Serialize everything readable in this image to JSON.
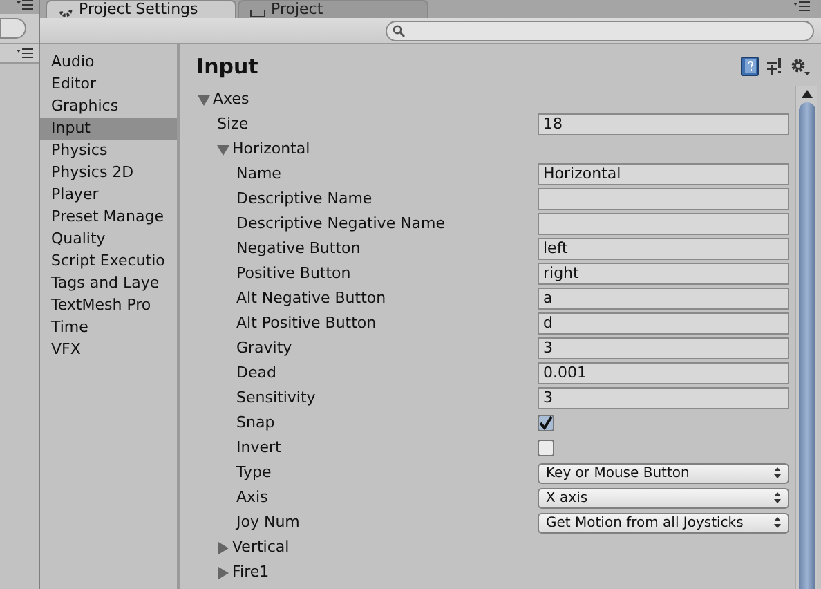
{
  "tabs": [
    {
      "label": "Project Settings",
      "selected": true
    },
    {
      "label": "Project",
      "selected": false
    }
  ],
  "sidebar": {
    "items": [
      {
        "label": "Audio",
        "selected": false
      },
      {
        "label": "Editor",
        "selected": false
      },
      {
        "label": "Graphics",
        "selected": false
      },
      {
        "label": "Input",
        "selected": true
      },
      {
        "label": "Physics",
        "selected": false
      },
      {
        "label": "Physics 2D",
        "selected": false
      },
      {
        "label": "Player",
        "selected": false
      },
      {
        "label": "Preset Manage",
        "selected": false
      },
      {
        "label": "Quality",
        "selected": false
      },
      {
        "label": "Script Executio",
        "selected": false
      },
      {
        "label": "Tags and Laye",
        "selected": false
      },
      {
        "label": "TextMesh Pro",
        "selected": false
      },
      {
        "label": "Time",
        "selected": false
      },
      {
        "label": "VFX",
        "selected": false
      }
    ]
  },
  "page_title": "Input",
  "properties": [
    {
      "kind": "foldout",
      "label": "Axes",
      "expanded": true,
      "children": [
        {
          "kind": "field",
          "label": "Size",
          "value": "18"
        },
        {
          "kind": "foldout",
          "label": "Horizontal",
          "expanded": true,
          "children": [
            {
              "kind": "field",
              "label": "Name",
              "value": "Horizontal"
            },
            {
              "kind": "field",
              "label": "Descriptive Name"
            },
            {
              "kind": "field",
              "label": "Descriptive Negative Name"
            },
            {
              "kind": "field",
              "label": "Negative Button",
              "value": "left"
            },
            {
              "kind": "field",
              "label": "Positive Button",
              "value": "right"
            },
            {
              "kind": "field",
              "label": "Alt Negative Button",
              "value": "a"
            },
            {
              "kind": "field",
              "label": "Alt Positive Button",
              "value": "d"
            },
            {
              "kind": "field",
              "label": "Gravity",
              "value": "3"
            },
            {
              "kind": "field",
              "label": "Dead",
              "value": "0.001"
            },
            {
              "kind": "field",
              "label": "Sensitivity",
              "value": "3"
            },
            {
              "kind": "checkbox",
              "label": "Snap",
              "checked": true
            },
            {
              "kind": "checkbox",
              "label": "Invert",
              "checked": false
            },
            {
              "kind": "dropdown",
              "label": "Type",
              "value": "Key or Mouse Button"
            },
            {
              "kind": "dropdown",
              "label": "Axis",
              "value": "X axis"
            },
            {
              "kind": "dropdown",
              "label": "Joy Num",
              "value": "Get Motion from all Joysticks"
            }
          ]
        },
        {
          "kind": "foldout",
          "label": "Vertical",
          "expanded": false
        },
        {
          "kind": "foldout",
          "label": "Fire1",
          "expanded": false
        }
      ]
    }
  ]
}
